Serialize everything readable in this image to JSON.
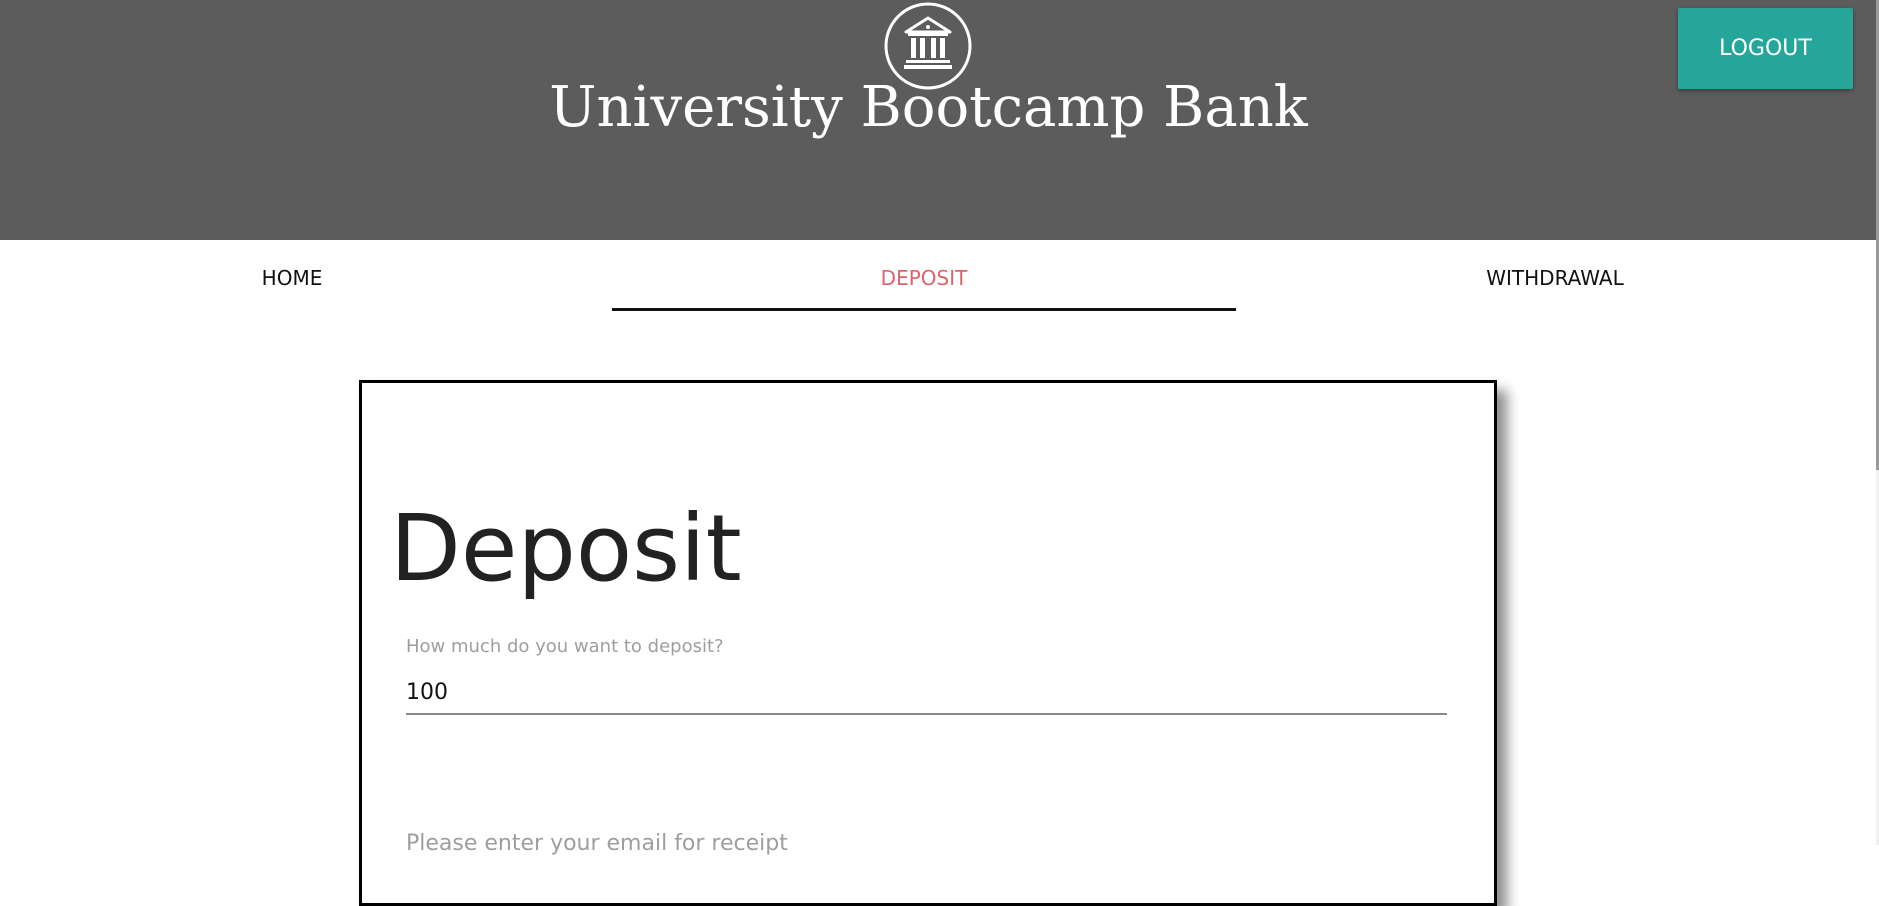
{
  "header": {
    "brand": "University Bootcamp Bank",
    "logo_icon": "bank-building-icon",
    "logout_label": "LOGOUT",
    "accent_color": "#26a69a"
  },
  "nav": {
    "tabs": [
      {
        "label": "HOME",
        "active": false
      },
      {
        "label": "DEPOSIT",
        "active": true
      },
      {
        "label": "WITHDRAWAL",
        "active": false
      }
    ],
    "active_color": "#d9646b"
  },
  "deposit_form": {
    "title": "Deposit",
    "amount_label": "How much do you want to deposit?",
    "amount_value": "100",
    "email_label": "Please enter your email for receipt"
  }
}
